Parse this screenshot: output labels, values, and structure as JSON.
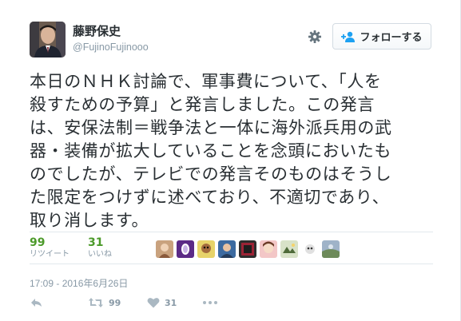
{
  "user": {
    "display_name": "藤野保史",
    "handle": "@FujinoFujinooo"
  },
  "follow_button": {
    "label": "フォローする"
  },
  "tweet": {
    "lines": [
      "本日のＮＨＫ討論で、軍事費について、「人を",
      "殺すための予算」と発言しました。この発言",
      "は、安保法制＝戦争法と一体に海外派兵用の武",
      "器・装備が拡大していることを念頭においたも",
      "のでしたが、テレビでの発言そのものはそうし",
      "た限定をつけずに述べており、不適切であり、",
      "取り消します。"
    ],
    "timestamp": "17:09 - 2016年6月26日"
  },
  "stats": {
    "retweets": {
      "count": "99",
      "label": "リツイート"
    },
    "likes": {
      "count": "31",
      "label": "いいね"
    }
  },
  "actions": {
    "retweet_count": "99",
    "like_count": "31"
  },
  "icons": [
    "gear-icon",
    "follow-user-icon",
    "reply-icon",
    "retweet-icon",
    "like-heart-icon",
    "more-icon"
  ],
  "colors": {
    "stat_count": "#4c9a2a",
    "muted": "#8899a6",
    "text": "#292f33"
  }
}
